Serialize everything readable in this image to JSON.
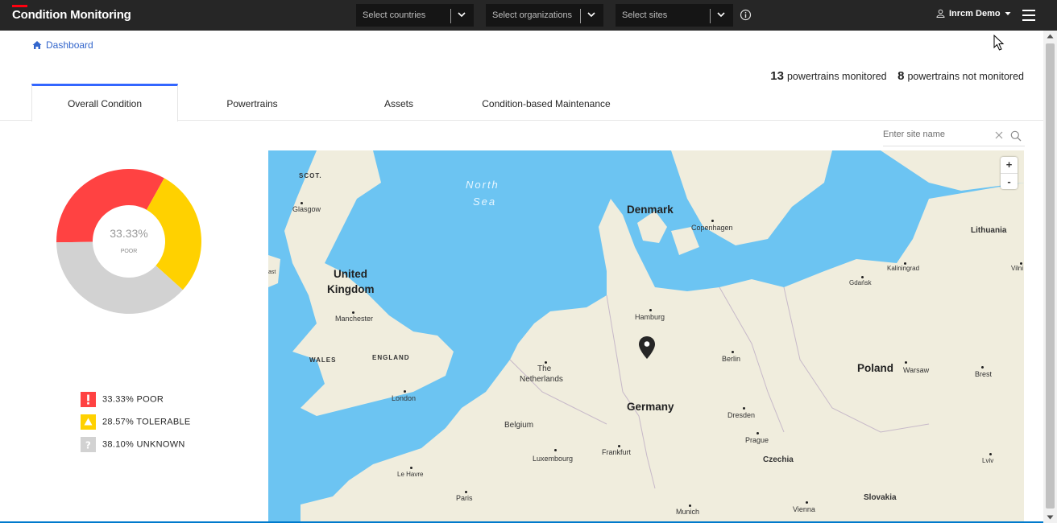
{
  "app": {
    "title": "Condition Monitoring",
    "accent_color": "#ff000f"
  },
  "filters": {
    "countries_placeholder": "Select countries",
    "organizations_placeholder": "Select organizations",
    "sites_placeholder": "Select sites"
  },
  "user": {
    "name": "Inrcm Demo"
  },
  "breadcrumb": {
    "label": "Dashboard"
  },
  "stats": {
    "monitored_count": "13",
    "monitored_label": "powertrains monitored",
    "not_monitored_count": "8",
    "not_monitored_label": "powertrains not monitored"
  },
  "tabs": [
    {
      "label": "Overall Condition",
      "active": true
    },
    {
      "label": "Powertrains",
      "active": false
    },
    {
      "label": "Assets",
      "active": false
    },
    {
      "label": "Condition-based Maintenance",
      "active": false
    }
  ],
  "site_search": {
    "placeholder": "Enter site name"
  },
  "donut": {
    "center_value": "33.33%",
    "center_label": "POOR",
    "segments": [
      {
        "name": "POOR",
        "percent": 33.33,
        "color": "#ff4242"
      },
      {
        "name": "TOLERABLE",
        "percent": 28.57,
        "color": "#ffd100"
      },
      {
        "name": "UNKNOWN",
        "percent": 38.1,
        "color": "#d2d2d2"
      }
    ]
  },
  "legend": [
    {
      "text": "33.33% POOR",
      "icon": "exclamation-icon",
      "color": "#ff4242"
    },
    {
      "text": "28.57% TOLERABLE",
      "icon": "warning-triangle-icon",
      "color": "#ffd100"
    },
    {
      "text": "38.10% UNKNOWN",
      "icon": "question-icon",
      "color": "#d2d2d2"
    }
  ],
  "map": {
    "zoom_in": "+",
    "zoom_out": "-",
    "labels": {
      "scot": "SCOT.",
      "glasgow": "Glasgow",
      "north": "North",
      "sea": "Sea",
      "denmark": "Denmark",
      "copenhagen": "Copenhagen",
      "lithuania": "Lithuania",
      "kaliningrad": "Kaliningrad",
      "vilni": "Vilni",
      "gdansk": "Gdańsk",
      "uk1": "United",
      "uk2": "Kingdom",
      "manchester": "Manchester",
      "hamburg": "Hamburg",
      "wales": "WALES",
      "england": "ENGLAND",
      "berlin": "Berlin",
      "the": "The",
      "netherlands": "Netherlands",
      "poland": "Poland",
      "warsaw": "Warsaw",
      "brest": "Brest",
      "london": "London",
      "germany": "Germany",
      "belgium": "Belgium",
      "dresden": "Dresden",
      "prague": "Prague",
      "luxembourg": "Luxembourg",
      "frankfurt": "Frankfurt",
      "czechia": "Czechia",
      "lviv": "Lviv",
      "lehavre": "Le Havre",
      "paris": "Paris",
      "slovakia": "Slovakia",
      "munich": "Munich",
      "vienna": "Vienna",
      "east": "ast"
    }
  }
}
